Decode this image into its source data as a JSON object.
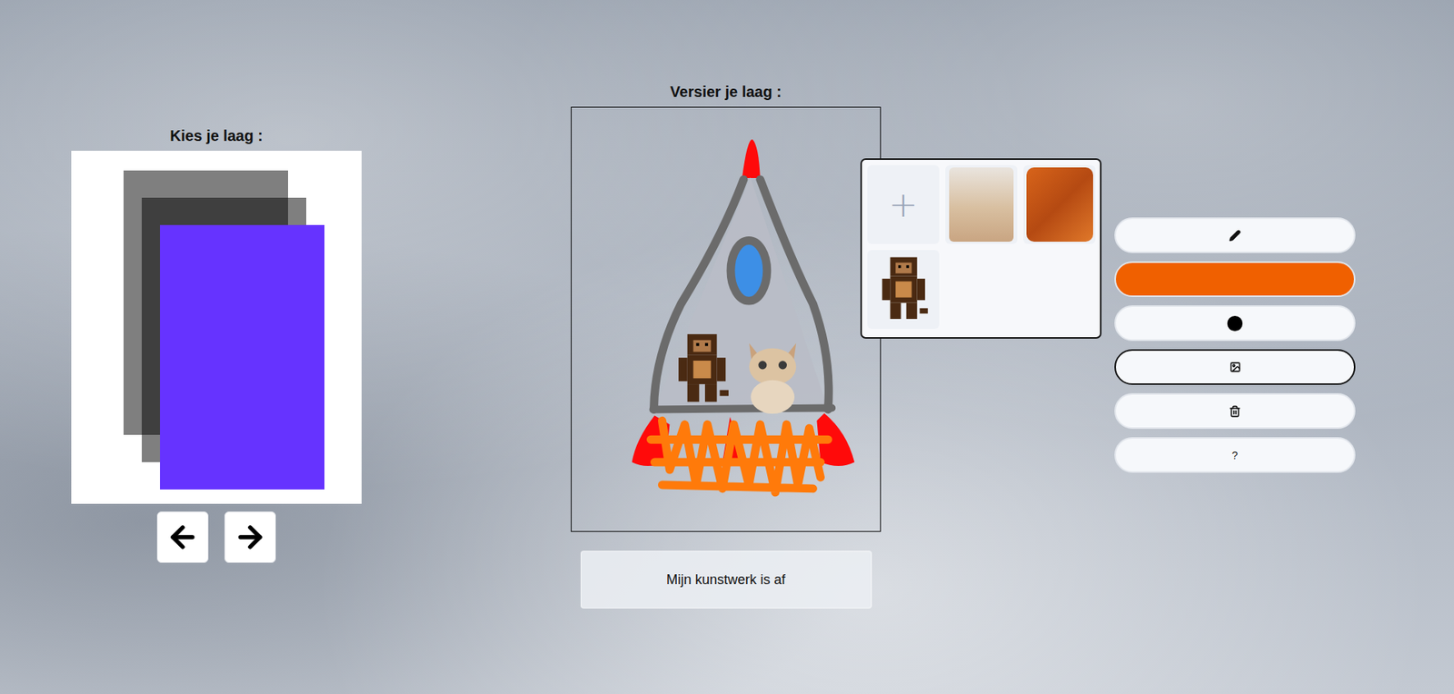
{
  "layers_panel": {
    "title": "Kies je laag :",
    "layers": [
      {
        "selected": false
      },
      {
        "selected": false
      },
      {
        "selected": true
      }
    ]
  },
  "editor": {
    "title": "Versier je laag :",
    "done_button": "Mijn kunstwerk is af"
  },
  "image_picker": {
    "open": true,
    "add_label": "+",
    "images": [
      {
        "kind": "cat"
      },
      {
        "kind": "lava"
      },
      {
        "kind": "monkey"
      }
    ]
  },
  "tools": [
    {
      "kind": "pencil",
      "selected": false
    },
    {
      "kind": "color",
      "selected": false,
      "color": "#f06000"
    },
    {
      "kind": "size",
      "selected": false
    },
    {
      "kind": "image",
      "selected": true
    },
    {
      "kind": "delete",
      "selected": false
    },
    {
      "kind": "help",
      "label": "?",
      "selected": false
    }
  ]
}
